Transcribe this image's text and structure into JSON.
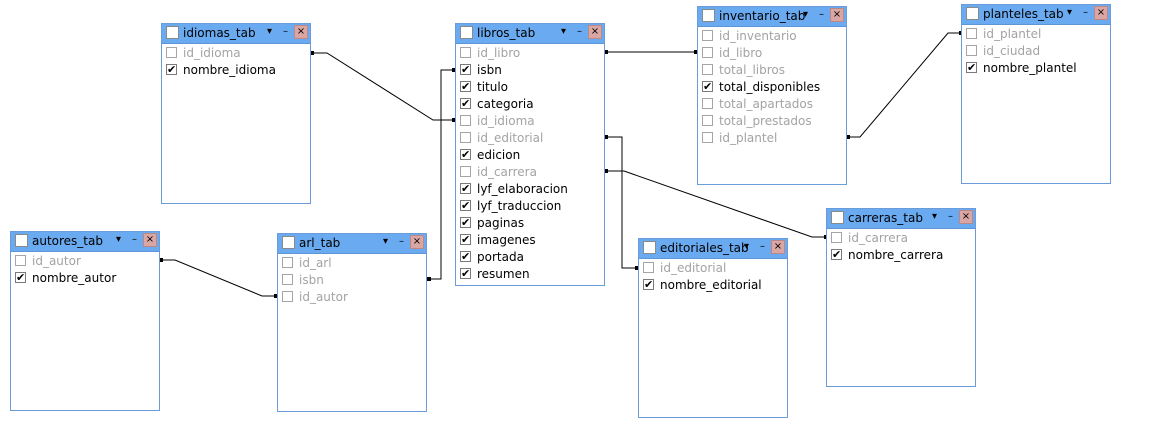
{
  "tables": [
    {
      "id": "idiomas",
      "title": "idiomas_tab",
      "fields": [
        {
          "name": "id_idioma",
          "checked": false
        },
        {
          "name": "nombre_idioma",
          "checked": true
        }
      ]
    },
    {
      "id": "libros",
      "title": "libros_tab",
      "fields": [
        {
          "name": "id_libro",
          "checked": false
        },
        {
          "name": "isbn",
          "checked": true
        },
        {
          "name": "titulo",
          "checked": true
        },
        {
          "name": "categoria",
          "checked": true
        },
        {
          "name": "id_idioma",
          "checked": false
        },
        {
          "name": "id_editorial",
          "checked": false
        },
        {
          "name": "edicion",
          "checked": true
        },
        {
          "name": "id_carrera",
          "checked": false
        },
        {
          "name": "lyf_elaboracion",
          "checked": true
        },
        {
          "name": "lyf_traduccion",
          "checked": true
        },
        {
          "name": "paginas",
          "checked": true
        },
        {
          "name": "imagenes",
          "checked": true
        },
        {
          "name": "portada",
          "checked": true
        },
        {
          "name": "resumen",
          "checked": true
        }
      ]
    },
    {
      "id": "inventario",
      "title": "inventario_tab",
      "fields": [
        {
          "name": "id_inventario",
          "checked": false
        },
        {
          "name": "id_libro",
          "checked": false
        },
        {
          "name": "total_libros",
          "checked": false
        },
        {
          "name": "total_disponibles",
          "checked": true
        },
        {
          "name": "total_apartados",
          "checked": false
        },
        {
          "name": "total_prestados",
          "checked": false
        },
        {
          "name": "id_plantel",
          "checked": false
        }
      ]
    },
    {
      "id": "planteles",
      "title": "planteles_tab",
      "fields": [
        {
          "name": "id_plantel",
          "checked": false
        },
        {
          "name": "id_ciudad",
          "checked": false
        },
        {
          "name": "nombre_plantel",
          "checked": true
        }
      ]
    },
    {
      "id": "autores",
      "title": "autores_tab",
      "fields": [
        {
          "name": "id_autor",
          "checked": false
        },
        {
          "name": "nombre_autor",
          "checked": true
        }
      ]
    },
    {
      "id": "arl",
      "title": "arl_tab",
      "fields": [
        {
          "name": "id_arl",
          "checked": false
        },
        {
          "name": "isbn",
          "checked": false
        },
        {
          "name": "id_autor",
          "checked": false
        }
      ]
    },
    {
      "id": "editoriales",
      "title": "editoriales_tab",
      "fields": [
        {
          "name": "id_editorial",
          "checked": false
        },
        {
          "name": "nombre_editorial",
          "checked": true
        }
      ]
    },
    {
      "id": "carreras",
      "title": "carreras_tab",
      "fields": [
        {
          "name": "id_carrera",
          "checked": false
        },
        {
          "name": "nombre_carrera",
          "checked": true
        }
      ]
    }
  ],
  "icons": {
    "menu": "dropdown-arrow-icon",
    "minimize": "minimize-icon",
    "close": "close-icon"
  },
  "colors": {
    "header": "#6aaaf0",
    "border": "#6b9bd8",
    "close": "#d9a6a3",
    "disabled_text": "#a3a3a3"
  }
}
